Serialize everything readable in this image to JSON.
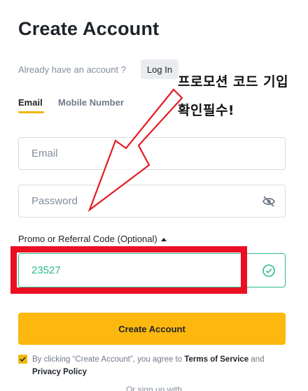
{
  "page": {
    "title": "Create Account"
  },
  "login_prompt": {
    "text": "Already have an account ?",
    "button_label": "Log In"
  },
  "tabs": [
    {
      "label": "Email",
      "active": true
    },
    {
      "label": "Mobile Number",
      "active": false
    }
  ],
  "form": {
    "email_placeholder": "Email",
    "password_placeholder": "Password",
    "password_visibility_icon": "eye-slash-icon",
    "promo_label": "Promo or Referral Code (Optional)",
    "promo_value": "23527",
    "promo_valid_icon": "check-circle-icon",
    "submit_label": "Create Account"
  },
  "agreement": {
    "checked": true,
    "prefix": "By clicking “Create Account”, you agree to",
    "terms_link": "Terms of Service",
    "conjunction": "and",
    "privacy_link": "Privacy Policy"
  },
  "footer": {
    "or_text": "Or sign up with"
  },
  "annotation": {
    "line1": "프로모션 코드 기입",
    "line2": "확인필수!"
  },
  "colors": {
    "accent": "#fcb80e",
    "valid": "#2ebd85",
    "highlight": "#ea0f23"
  }
}
